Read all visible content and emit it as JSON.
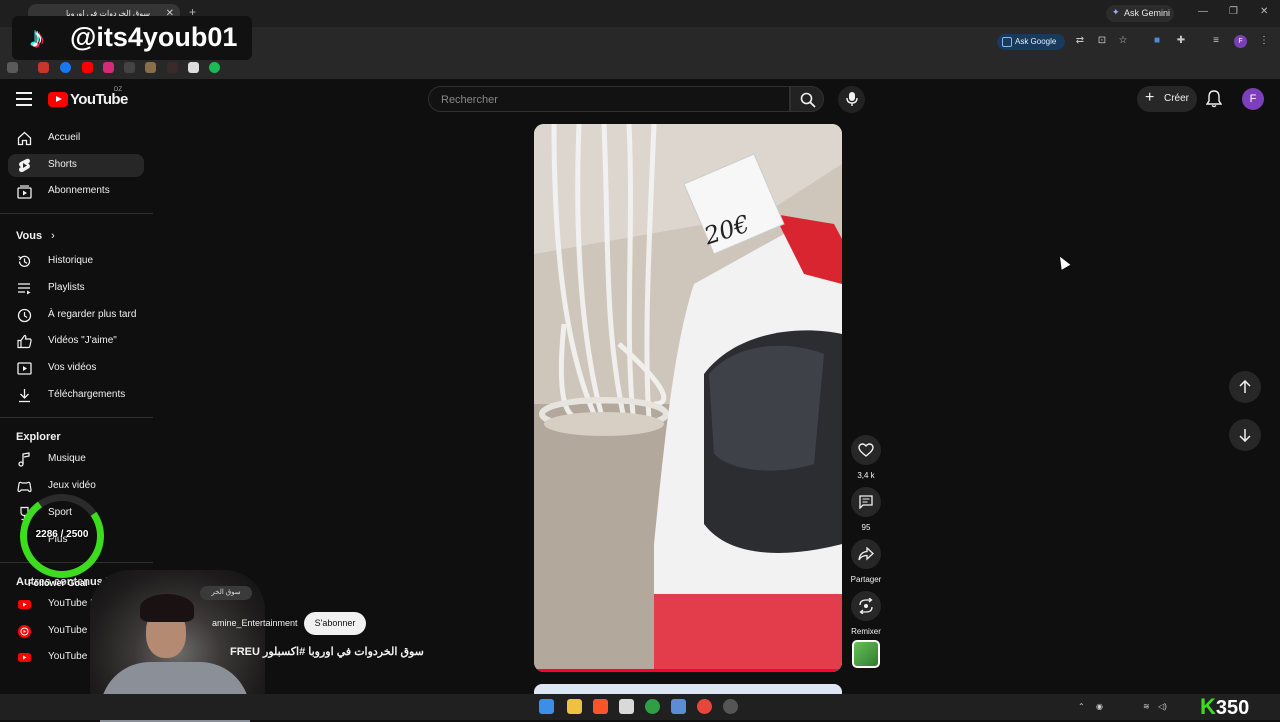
{
  "browser": {
    "tab_title": "سوق الخردوات في اوروبا",
    "tab_close": "✕",
    "new_tab": "+",
    "gemini_label": "Ask Gemini",
    "ask_google_label": "Ask Google",
    "profile_initial": "F",
    "window_controls": [
      "—",
      "❐",
      "✕"
    ]
  },
  "overlay": {
    "tiktok_handle": "@its4youb01",
    "goal_count": "2286 / 2500",
    "goal_label": "Follower Goal",
    "goal_progress": 0.9144,
    "corner_counter": "350",
    "corner_letter": "K"
  },
  "youtube": {
    "logo_text": "YouTube",
    "country_code": "DZ",
    "search_placeholder": "Rechercher",
    "create_label": "Créer",
    "avatar_initial": "F"
  },
  "sidebar": {
    "main": [
      {
        "label": "Accueil",
        "icon": "home-icon"
      },
      {
        "label": "Shorts",
        "icon": "shorts-icon",
        "active": true
      },
      {
        "label": "Abonnements",
        "icon": "subscriptions-icon"
      }
    ],
    "you_heading": "Vous",
    "you": [
      {
        "label": "Historique",
        "icon": "history-icon"
      },
      {
        "label": "Playlists",
        "icon": "playlists-icon"
      },
      {
        "label": "À regarder plus tard",
        "icon": "watch-later-icon"
      },
      {
        "label": "Vidéos \"J'aime\"",
        "icon": "like-icon"
      },
      {
        "label": "Vos vidéos",
        "icon": "your-videos-icon"
      },
      {
        "label": "Téléchargements",
        "icon": "downloads-icon"
      }
    ],
    "explore_heading": "Explorer",
    "explore": [
      {
        "label": "Musique",
        "icon": "music-icon"
      },
      {
        "label": "Jeux vidéo",
        "icon": "gaming-icon"
      },
      {
        "label": "Sport",
        "icon": "sport-icon"
      },
      {
        "label": "Plus",
        "icon": "more-icon"
      }
    ],
    "other_heading": "Autres contenus YouTube",
    "other": [
      {
        "label": "YouTube Premium",
        "icon": "youtube-premium-icon"
      },
      {
        "label": "YouTube Music",
        "icon": "youtube-music-icon"
      },
      {
        "label": "YouTube Kids",
        "icon": "youtube-kids-icon"
      }
    ]
  },
  "short": {
    "price_tag": "20€",
    "sound_chip": "سوق الخر",
    "channel_name": "amine_Entertainment",
    "subscribe_label": "S'abonner",
    "title": "سوق الخردوات في اوروبا #اكسبلور FREU",
    "likes": "3,4 k",
    "comments": "95",
    "share_label": "Partager",
    "remix_label": "Remixer",
    "progress": 0.98
  },
  "colors": {
    "youtube_red": "#ff0000",
    "goal_green": "#3ddc1e",
    "background": "#0f0f0f"
  }
}
